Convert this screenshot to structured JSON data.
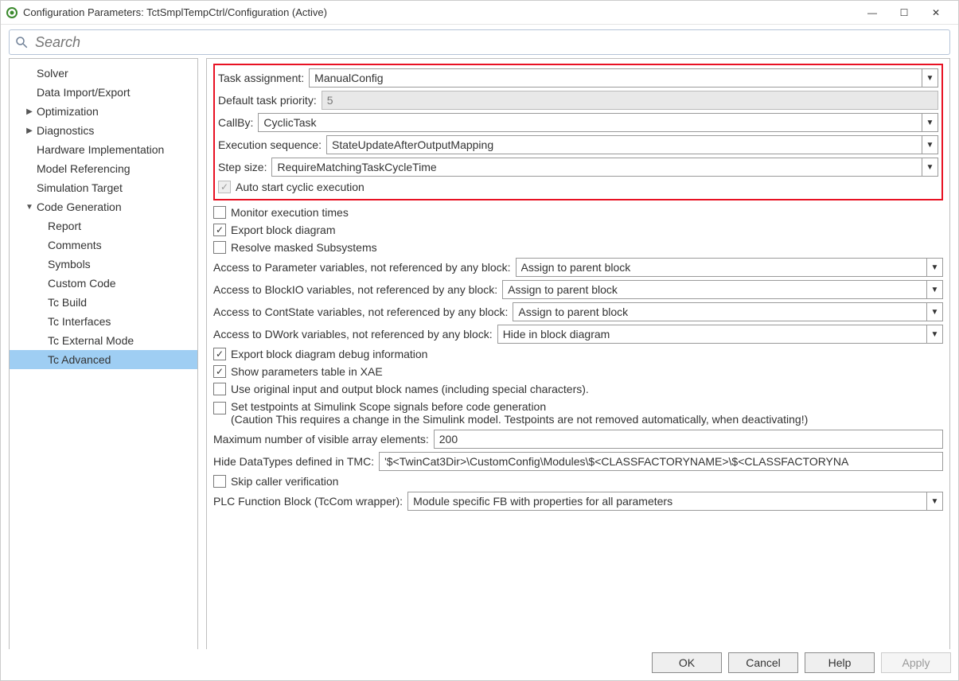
{
  "window": {
    "title": "Configuration Parameters: TctSmplTempCtrl/Configuration (Active)"
  },
  "search": {
    "placeholder": "Search"
  },
  "sidebar": {
    "items": [
      {
        "label": "Solver",
        "indent": 1,
        "arrow": ""
      },
      {
        "label": "Data Import/Export",
        "indent": 1,
        "arrow": ""
      },
      {
        "label": "Optimization",
        "indent": 1,
        "arrow": "▶"
      },
      {
        "label": "Diagnostics",
        "indent": 1,
        "arrow": "▶"
      },
      {
        "label": "Hardware Implementation",
        "indent": 1,
        "arrow": ""
      },
      {
        "label": "Model Referencing",
        "indent": 1,
        "arrow": ""
      },
      {
        "label": "Simulation Target",
        "indent": 1,
        "arrow": ""
      },
      {
        "label": "Code Generation",
        "indent": 1,
        "arrow": "▼"
      },
      {
        "label": "Report",
        "indent": 2,
        "arrow": ""
      },
      {
        "label": "Comments",
        "indent": 2,
        "arrow": ""
      },
      {
        "label": "Symbols",
        "indent": 2,
        "arrow": ""
      },
      {
        "label": "Custom Code",
        "indent": 2,
        "arrow": ""
      },
      {
        "label": "Tc Build",
        "indent": 2,
        "arrow": ""
      },
      {
        "label": "Tc Interfaces",
        "indent": 2,
        "arrow": ""
      },
      {
        "label": "Tc External Mode",
        "indent": 2,
        "arrow": ""
      },
      {
        "label": "Tc Advanced",
        "indent": 2,
        "arrow": "",
        "selected": true
      }
    ]
  },
  "main": {
    "taskAssignment": {
      "label": "Task assignment:",
      "value": "ManualConfig"
    },
    "defaultTaskPriority": {
      "label": "Default task priority:",
      "value": "5"
    },
    "callBy": {
      "label": "CallBy:",
      "value": "CyclicTask"
    },
    "execSeq": {
      "label": "Execution sequence:",
      "value": "StateUpdateAfterOutputMapping"
    },
    "stepSize": {
      "label": "Step size:",
      "value": "RequireMatchingTaskCycleTime"
    },
    "autoStart": {
      "label": "Auto start cyclic execution",
      "checked": true,
      "disabled": true
    },
    "monitorTimes": {
      "label": "Monitor execution times",
      "checked": false
    },
    "exportBlockDiag": {
      "label": "Export block diagram",
      "checked": true
    },
    "resolveMasked": {
      "label": "Resolve masked Subsystems",
      "checked": false
    },
    "accessParam": {
      "label": "Access to Parameter variables, not referenced by any block:",
      "value": "Assign to parent block"
    },
    "accessBlockIO": {
      "label": "Access to BlockIO variables, not referenced by any block:",
      "value": "Assign to parent block"
    },
    "accessContState": {
      "label": "Access to ContState variables, not referenced by any block:",
      "value": "Assign to parent block"
    },
    "accessDWork": {
      "label": "Access to DWork variables, not referenced by any block:",
      "value": "Hide in block diagram"
    },
    "exportDebug": {
      "label": "Export block diagram debug information",
      "checked": true
    },
    "showParamsXAE": {
      "label": "Show parameters table in XAE",
      "checked": true
    },
    "useOrigNames": {
      "label": "Use original input and output block names (including special characters).",
      "checked": false
    },
    "setTestpoints": {
      "label": "Set testpoints at Simulink Scope signals before code generation\n(Caution This requires a change in the Simulink model. Testpoints are not removed automatically, when deactivating!)",
      "checked": false
    },
    "maxVisibleArray": {
      "label": "Maximum number of visible array elements:",
      "value": "200"
    },
    "hideDataTypes": {
      "label": "Hide DataTypes defined in TMC:",
      "value": "'$<TwinCat3Dir>\\CustomConfig\\Modules\\$<CLASSFACTORYNAME>\\$<CLASSFACTORYNA"
    },
    "skipCaller": {
      "label": "Skip caller verification",
      "checked": false
    },
    "plcFbWrapper": {
      "label": "PLC Function Block (TcCom wrapper):",
      "value": "Module specific FB with properties for all parameters"
    }
  },
  "footer": {
    "ok": "OK",
    "cancel": "Cancel",
    "help": "Help",
    "apply": "Apply"
  }
}
